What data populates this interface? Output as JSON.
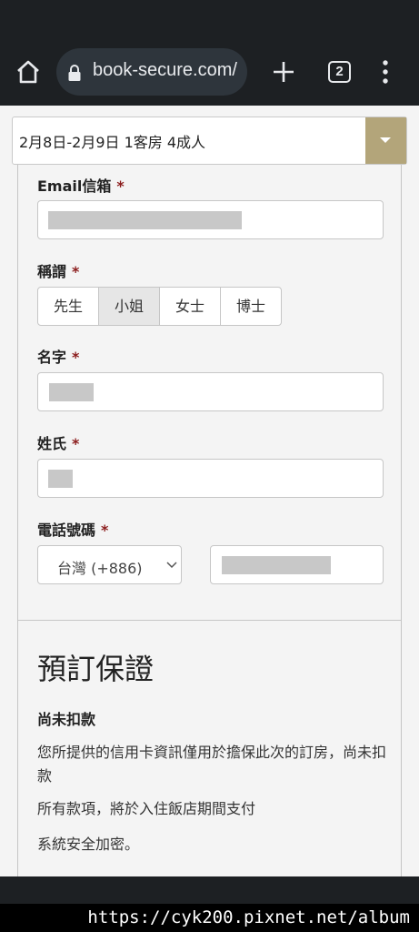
{
  "browser": {
    "url": "book-secure.com/",
    "tab_count": "2",
    "icons": [
      "home-icon",
      "lock-icon",
      "plus-icon",
      "tabs-icon",
      "more-vert-icon"
    ]
  },
  "booking": {
    "summary": "2月8日-2月9日  1客房 4成人",
    "toggle_color": "#b3a57a"
  },
  "form": {
    "email": {
      "label": "Email信箱",
      "required_mark": "*"
    },
    "salutation": {
      "label": "稱謂",
      "required_mark": "*",
      "options": [
        "先生",
        "小姐",
        "女士",
        "博士"
      ],
      "selected": "小姐"
    },
    "first_name": {
      "label": "名字",
      "required_mark": "*"
    },
    "last_name": {
      "label": "姓氏",
      "required_mark": "*"
    },
    "phone": {
      "label": "電話號碼",
      "required_mark": "*",
      "country_code": "台灣 (+886)"
    }
  },
  "guarantee": {
    "title": "預訂保證",
    "subtitle": "尚未扣款",
    "line1": "您所提供的信用卡資訊僅用於擔保此次的訂房，尚未扣款",
    "line2": "所有款項，將於入住飯店期間支付",
    "line3": "系統安全加密。"
  },
  "caption": "https://cyk200.pixnet.net/album",
  "colors": {
    "required": "#8b1c1c",
    "accent": "#b3a57a",
    "chrome": "#1d2023"
  }
}
